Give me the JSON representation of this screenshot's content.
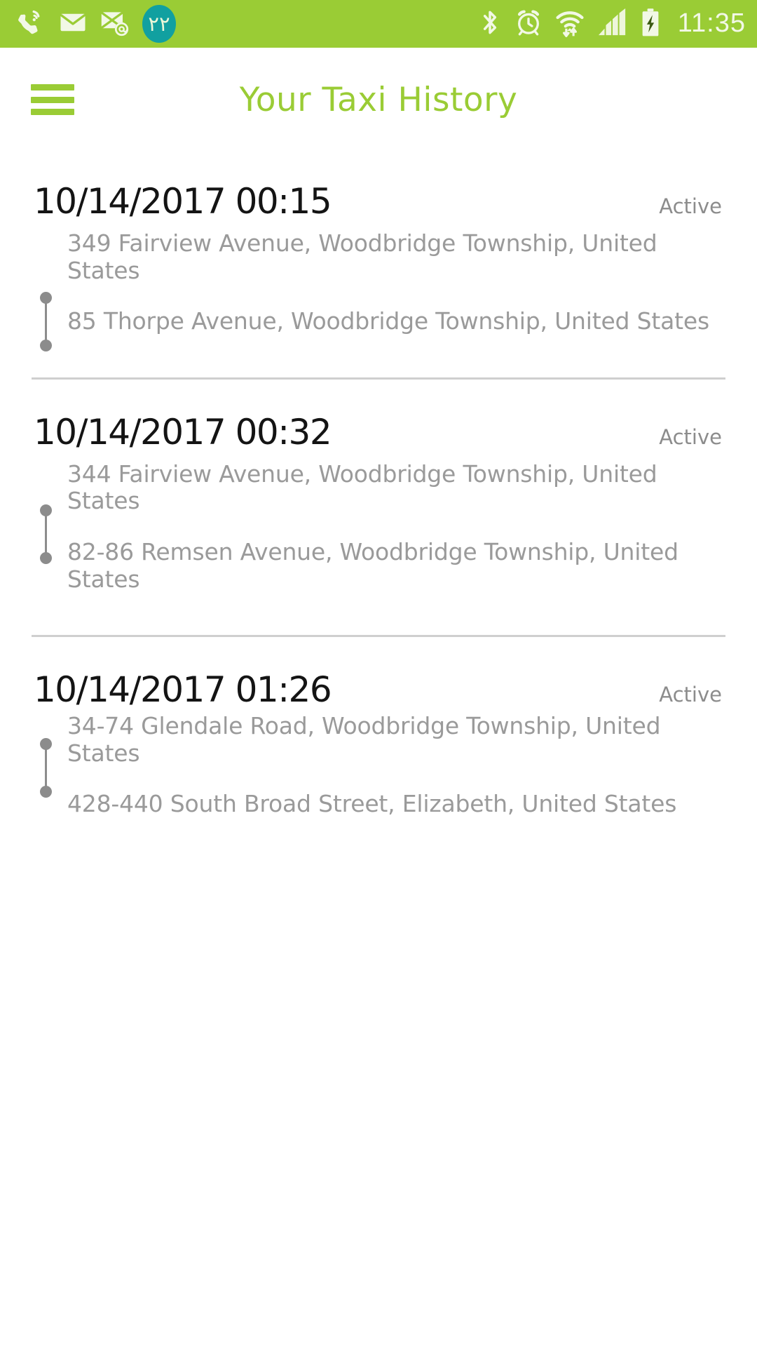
{
  "status_bar": {
    "background_color": "#9ACC35",
    "foreground_color": "#F2F8E6",
    "time": "11:35",
    "badge": {
      "text": "٢٢",
      "background_color": "#11A0A0"
    },
    "left_icons": [
      {
        "name": "wifi-call-icon",
        "label": "Wi-Fi calling"
      },
      {
        "name": "sms-message-icon",
        "label": "New SMS message"
      },
      {
        "name": "email-at-icon",
        "label": "New email"
      },
      {
        "name": "notification-count-badge",
        "label": "22 notifications"
      }
    ],
    "right_icons": [
      {
        "name": "bluetooth-icon",
        "label": "Bluetooth"
      },
      {
        "name": "alarm-clock-icon",
        "label": "Alarm set"
      },
      {
        "name": "wifi-transfer-icon",
        "label": "Wi-Fi data transfer"
      },
      {
        "name": "cellular-signal-icon",
        "label": "Cellular signal"
      },
      {
        "name": "battery-charging-icon",
        "label": "Battery charging"
      }
    ]
  },
  "header": {
    "title": "Your Taxi History",
    "title_color": "#9ACC35",
    "menu_icon": "hamburger-menu-icon"
  },
  "trips": [
    {
      "datetime": "10/14/2017 00:15",
      "status": "Active",
      "origin": "349 Fairview Avenue, Woodbridge Township, United States",
      "destination": "85 Thorpe Avenue, Woodbridge Township, United States"
    },
    {
      "datetime": "10/14/2017 00:32",
      "status": "Active",
      "origin": "344 Fairview Avenue, Woodbridge Township, United States",
      "destination": "82-86 Remsen Avenue, Woodbridge Township, United States"
    },
    {
      "datetime": "10/14/2017 01:26",
      "status": "Active",
      "origin": "34-74 Glendale Road, Woodbridge Township, United States",
      "destination": "428-440 South Broad Street, Elizabeth, United States"
    }
  ]
}
